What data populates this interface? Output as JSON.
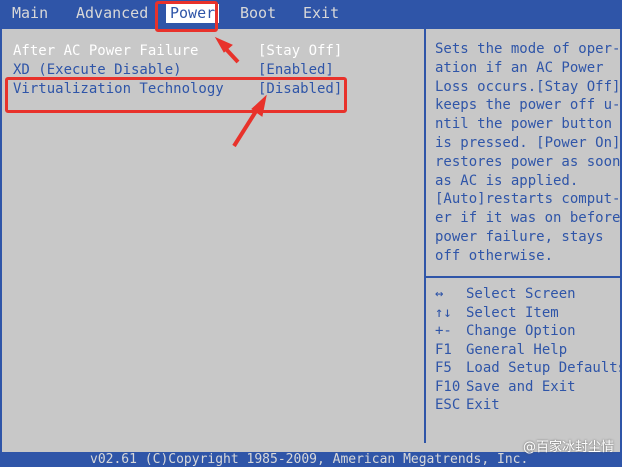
{
  "menu": {
    "items": [
      {
        "label": "Main"
      },
      {
        "label": "Advanced"
      },
      {
        "label": "Power"
      },
      {
        "label": "Boot"
      },
      {
        "label": "Exit"
      }
    ],
    "active": "Power"
  },
  "settings": [
    {
      "label": "After AC Power Failure",
      "value": "[Stay Off]"
    },
    {
      "label": "XD (Execute Disable)",
      "value": "[Enabled]"
    },
    {
      "label": "Virtualization Technology",
      "value": "[Disabled]"
    }
  ],
  "help": {
    "text": "Sets the mode of oper-\nation if an AC Power\nLoss occurs.[Stay Off]\nkeeps the power off u-\nntil the power button\nis pressed. [Power On]\nrestores power as soon\nas AC is applied.\n[Auto]restarts comput-\ner if it was on before\npower failure, stays\noff otherwise."
  },
  "keys": [
    {
      "key": "↔",
      "desc": "Select Screen"
    },
    {
      "key": "↑↓",
      "desc": "Select Item"
    },
    {
      "key": "+-",
      "desc": "Change Option"
    },
    {
      "key": "F1",
      "desc": "General Help"
    },
    {
      "key": "F5",
      "desc": "Load Setup Defaults"
    },
    {
      "key": "F10",
      "desc": "Save and Exit"
    },
    {
      "key": "ESC",
      "desc": "Exit"
    }
  ],
  "footer": {
    "copyright": "v02.61 (C)Copyright 1985-2009, American Megatrends, Inc."
  },
  "watermark": "@百家冰封尘情",
  "colors": {
    "bios_blue": "#2f55a8",
    "bios_gray": "#c8c8c8",
    "highlight_red": "#e8322b"
  }
}
